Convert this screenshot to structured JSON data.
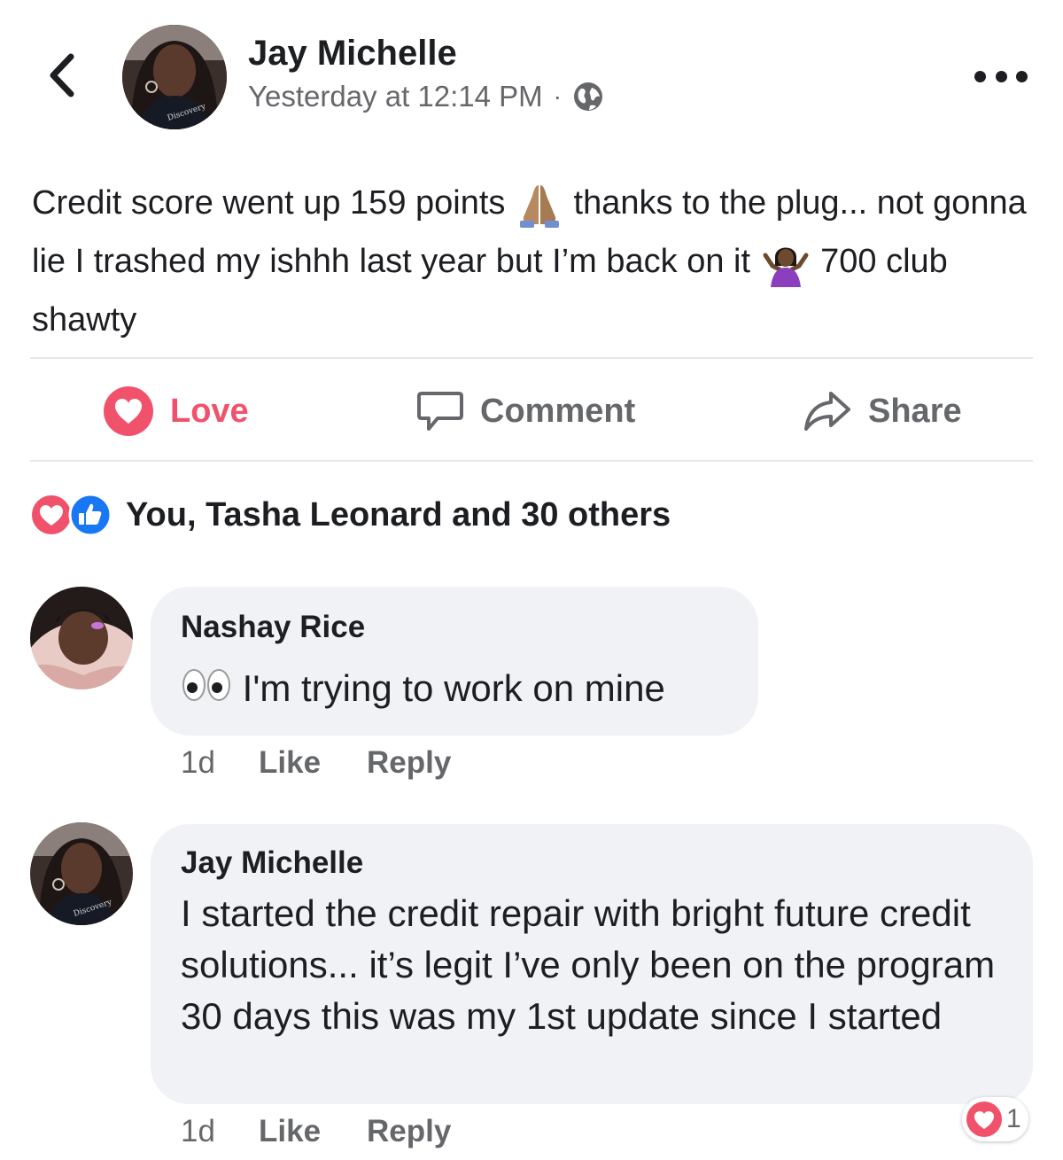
{
  "post": {
    "author": "Jay Michelle",
    "timestamp": "Yesterday at 12:14 PM",
    "separator": "·",
    "privacy_icon": "globe-icon",
    "text_part1": "Credit score went up 159 points ",
    "text_part2": " thanks to the plug... not gonna lie I trashed my ishhh last year but I’m back on it ",
    "text_part3": " 700 club shawty",
    "emoji_1": "folded-hands-emoji",
    "emoji_2": "person-shrugging-emoji"
  },
  "actions": {
    "love_label": "Love",
    "comment_label": "Comment",
    "share_label": "Share"
  },
  "reactions": {
    "summary": "You, Tasha Leonard and 30 others",
    "icons": [
      "love-reaction-icon",
      "like-reaction-icon"
    ]
  },
  "comments": [
    {
      "author": "Nashay Rice",
      "emoji": "eyes-emoji",
      "text": " I'm trying to work on mine",
      "time": "1d",
      "like_label": "Like",
      "reply_label": "Reply"
    },
    {
      "author": "Jay Michelle",
      "text": "I started the credit repair with bright future credit solutions... it’s legit I’ve only been on the program 30 days this was my 1st update since I started",
      "time": "1d",
      "like_label": "Like",
      "reply_label": "Reply",
      "reaction_count": "1"
    }
  ],
  "colors": {
    "love": "#f0526c",
    "like": "#1877f2",
    "secondary_text": "#65676b",
    "bubble": "#f0f2f5"
  }
}
